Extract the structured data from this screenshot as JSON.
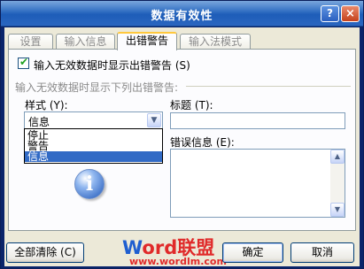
{
  "window": {
    "title": "数据有效性",
    "help_glyph": "?",
    "close_glyph": "×"
  },
  "tabs": [
    {
      "label": "设置",
      "active": false
    },
    {
      "label": "输入信息",
      "active": false
    },
    {
      "label": "出错警告",
      "active": true
    },
    {
      "label": "输入法模式",
      "active": false
    }
  ],
  "error_alert": {
    "show_alert_checkbox_label": "输入无效数据时显示出错警告 (S)",
    "show_alert_checked": true,
    "group_label": "输入无效数据时显示下列出错警告:",
    "style_label": "样式 (Y):",
    "style_value": "信息",
    "style_options": [
      "停止",
      "警告",
      "信息"
    ],
    "style_selected": "信息",
    "title_label": "标题 (T):",
    "title_value": "",
    "message_label": "错误信息 (E):",
    "message_value": "",
    "icon": "info-icon",
    "icon_glyph": "i"
  },
  "footer": {
    "clear_all_label": "全部清除 (C)",
    "ok_label": "确定",
    "cancel_label": "取消"
  },
  "watermark": {
    "brand_w": "W",
    "brand_rest": "ord联盟",
    "url": "www.wordlm.com"
  },
  "colors": {
    "titlebar": "#2a66c0",
    "selection": "#316ac5",
    "tab_highlight": "#ffc83c",
    "dialog_bg": "#ece9d8"
  }
}
